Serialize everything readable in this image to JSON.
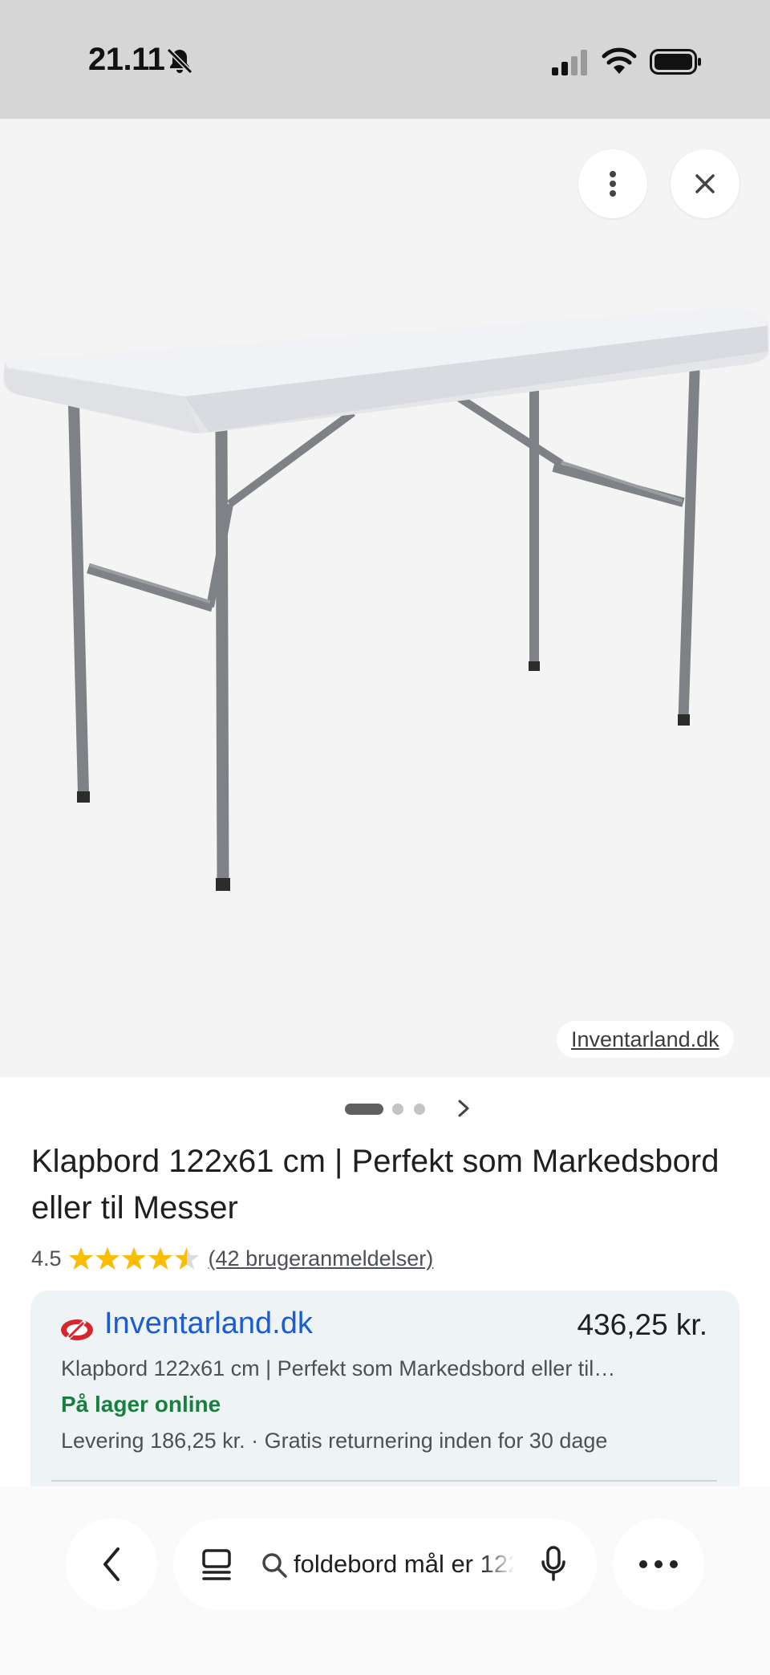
{
  "status_bar": {
    "time": "21.11",
    "icons": [
      "bell-off-icon",
      "cellular-signal-icon",
      "wifi-icon",
      "battery-icon"
    ]
  },
  "image_viewer": {
    "image_description_name": "folding-table-image",
    "more_icon": "vertical-dots-icon",
    "close_icon": "close-icon",
    "source_label": "Inventarland.dk",
    "carousel_pages": 3,
    "carousel_active_index": 0
  },
  "product": {
    "title": "Klapbord 122x61 cm | Perfekt som Markedsbord eller til Messer",
    "rating": "4.5",
    "rating_value": 4.5,
    "rating_max": 5,
    "reviews": "(42 brugeranmeldelser)"
  },
  "offer": {
    "merchant": "Inventarland.dk",
    "price": "436,25 kr.",
    "description": "Klapbord 122x61 cm | Perfekt som Markedsbord eller til…",
    "stock": "På lager online",
    "delivery": "Levering 186,25 kr. · Gratis returnering inden for 30 dage",
    "colors": {
      "merchant_link": "#1a5bd6",
      "stock": "#18803c",
      "star": "#fbbc04"
    }
  },
  "bottom_bar": {
    "search_query": "foldebord mål er 122",
    "icons": [
      "back-chevron-icon",
      "tabs-icon",
      "search-icon",
      "microphone-icon",
      "more-horizontal-icon"
    ]
  }
}
